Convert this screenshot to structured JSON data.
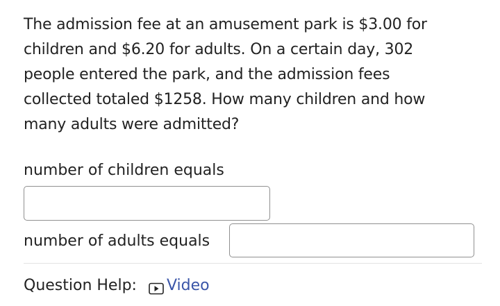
{
  "question": {
    "lines": [
      "The admission fee at an amusement park is $3.00 for",
      "children and $6.20 for adults. On a certain day, 302",
      "people entered the park, and the admission fees",
      "collected totaled $1258. How many children and how",
      "many adults were admitted?"
    ]
  },
  "answers": {
    "children_label": "number of children equals",
    "children_value": "",
    "adults_label": "number of adults equals",
    "adults_value": ""
  },
  "help": {
    "label": "Question Help:",
    "video_label": "Video",
    "video_icon": "video-play-icon",
    "link_color": "#3a55a8"
  }
}
